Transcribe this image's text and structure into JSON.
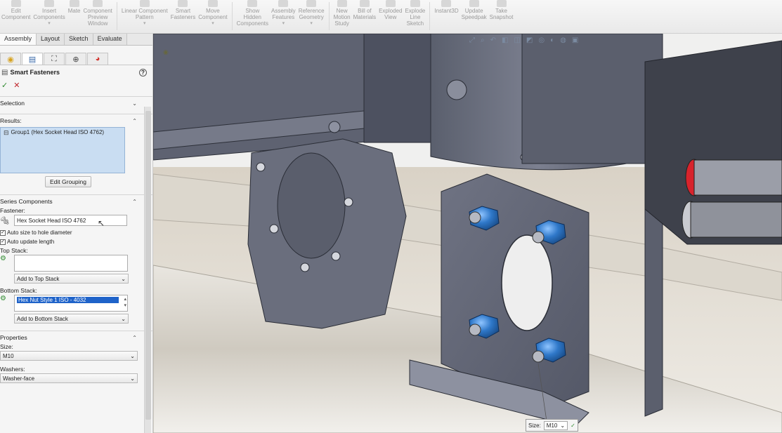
{
  "ribbon": {
    "buttons": [
      {
        "label": "Edit\nComponent",
        "icon": "edit-component-icon"
      },
      {
        "label": "Insert\nComponents",
        "icon": "insert-components-icon",
        "dropdown": true
      },
      {
        "label": "Mate",
        "icon": "mate-icon"
      },
      {
        "label": "Component\nPreview\nWindow",
        "icon": "component-preview-icon"
      },
      {
        "label": "Linear Component\nPattern",
        "icon": "linear-pattern-icon",
        "dropdown": true
      },
      {
        "label": "Smart\nFasteners",
        "icon": "smart-fasteners-icon"
      },
      {
        "label": "Move\nComponent",
        "icon": "move-component-icon",
        "dropdown": true
      },
      {
        "label": "Show\nHidden\nComponents",
        "icon": "show-hidden-icon"
      },
      {
        "label": "Assembly\nFeatures",
        "icon": "assembly-features-icon",
        "dropdown": true
      },
      {
        "label": "Reference\nGeometry",
        "icon": "reference-geometry-icon",
        "dropdown": true
      },
      {
        "label": "New\nMotion\nStudy",
        "icon": "motion-study-icon"
      },
      {
        "label": "Bill of\nMaterials",
        "icon": "bom-icon"
      },
      {
        "label": "Exploded\nView",
        "icon": "exploded-view-icon"
      },
      {
        "label": "Explode\nLine\nSketch",
        "icon": "explode-line-icon"
      },
      {
        "label": "Instant3D",
        "icon": "instant3d-icon"
      },
      {
        "label": "Update\nSpeedpak",
        "icon": "speedpak-icon"
      },
      {
        "label": "Take\nSnapshot",
        "icon": "snapshot-icon"
      }
    ]
  },
  "command_tabs": [
    "Assembly",
    "Layout",
    "Sketch",
    "Evaluate"
  ],
  "property_manager": {
    "title": "Smart Fasteners",
    "help_label": "?",
    "ok_label": "✓",
    "cancel_label": "✕",
    "selection": {
      "header": "Selection"
    },
    "results": {
      "header": "Results:",
      "item": "Group1 (Hex Socket Head ISO 4762)",
      "edit_button": "Edit Grouping"
    },
    "series": {
      "header": "Series Components",
      "fastener_label": "Fastener:",
      "fastener_value": "Hex Socket Head ISO 4762",
      "auto_size": "Auto size to hole diameter",
      "auto_update": "Auto update length",
      "top_stack_label": "Top Stack:",
      "top_stack_value": "",
      "top_stack_add": "Add to Top Stack",
      "bottom_stack_label": "Bottom Stack:",
      "bottom_stack_value": "Hex Nut Style 1 ISO - 4032",
      "bottom_stack_add": "Add to Bottom Stack"
    },
    "properties": {
      "header": "Properties",
      "size_label": "Size:",
      "size_value": "M10",
      "washers_label": "Washers:",
      "washers_value": "Washer-face"
    }
  },
  "viewport": {
    "size_callout_label": "Size:",
    "size_callout_value": "M10",
    "size_callout_ok": "✓"
  },
  "colors": {
    "metal_dark": "#4a4f5e",
    "metal_mid": "#6b7080",
    "metal_light": "#8b90a0",
    "fastener_blue": "#2f78c9",
    "results_blue": "#c9ddf2",
    "selection_blue": "#1f63c9"
  }
}
